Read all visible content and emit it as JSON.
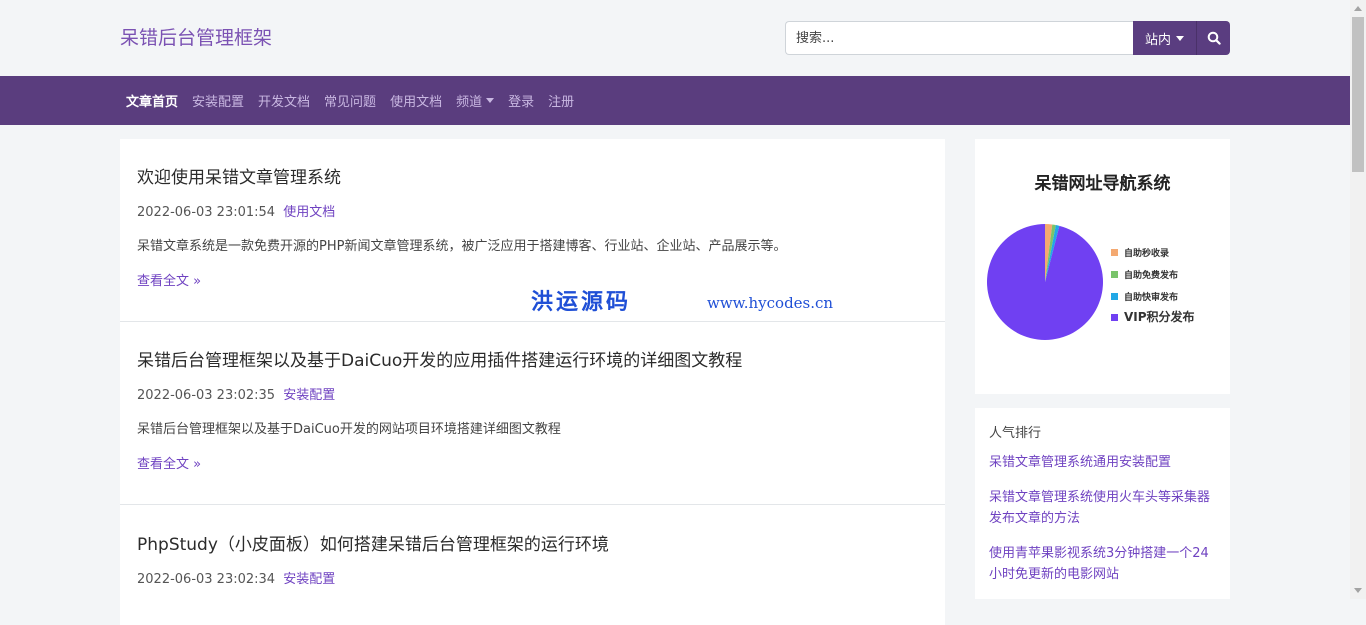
{
  "header": {
    "brand": "呆错后台管理框架",
    "search": {
      "placeholder": "搜索...",
      "scope": "站内"
    }
  },
  "nav": {
    "items": [
      {
        "label": "文章首页",
        "active": true
      },
      {
        "label": "安装配置"
      },
      {
        "label": "开发文档"
      },
      {
        "label": "常见问题"
      },
      {
        "label": "使用文档"
      },
      {
        "label": "频道",
        "dropdown": true
      },
      {
        "label": "登录"
      },
      {
        "label": "注册"
      }
    ]
  },
  "articles": [
    {
      "title": "欢迎使用呆错文章管理系统",
      "datetime": "2022-06-03 23:01:54",
      "category": "使用文档",
      "summary": "呆错文章系统是一款免费开源的PHP新闻文章管理系统，被广泛应用于搭建博客、行业站、企业站、产品展示等。",
      "readmore": "查看全文 »"
    },
    {
      "title": "呆错后台管理框架以及基于DaiCuo开发的应用插件搭建运行环境的详细图文教程",
      "datetime": "2022-06-03 23:02:35",
      "category": "安装配置",
      "summary": "呆错后台管理框架以及基于DaiCuo开发的网站项目环境搭建详细图文教程",
      "readmore": "查看全文 »"
    },
    {
      "title": "PhpStudy（小皮面板）如何搭建呆错后台管理框架的运行环境",
      "datetime": "2022-06-03 23:02:34",
      "category": "安装配置"
    }
  ],
  "sidebar": {
    "promo": {
      "title": "呆错网址导航系统",
      "legend": [
        {
          "label": "自助秒收录",
          "color": "#f4a971"
        },
        {
          "label": "自助免费发布",
          "color": "#7ac46b"
        },
        {
          "label": "自助快审发布",
          "color": "#22a8e6"
        },
        {
          "label": "VIP积分发布",
          "color": "#7040f2"
        }
      ],
      "pie_shares": [
        0.02,
        0.01,
        0.01,
        0.96
      ]
    },
    "popular": {
      "title": "人气排行",
      "items": [
        "呆错文章管理系统通用安装配置",
        "呆错文章管理系统使用火车头等采集器发布文章的方法",
        "使用青苹果影视系统3分钟搭建一个24小时免更新的电影网站"
      ]
    }
  },
  "watermark": {
    "cn": "洪运源码",
    "en": "www.hycodes.cn"
  },
  "colors": {
    "brand": "#7b52b3",
    "nav_bg": "#5a3d7e",
    "link": "#6f42c1",
    "page_bg": "#f3f5f7"
  }
}
